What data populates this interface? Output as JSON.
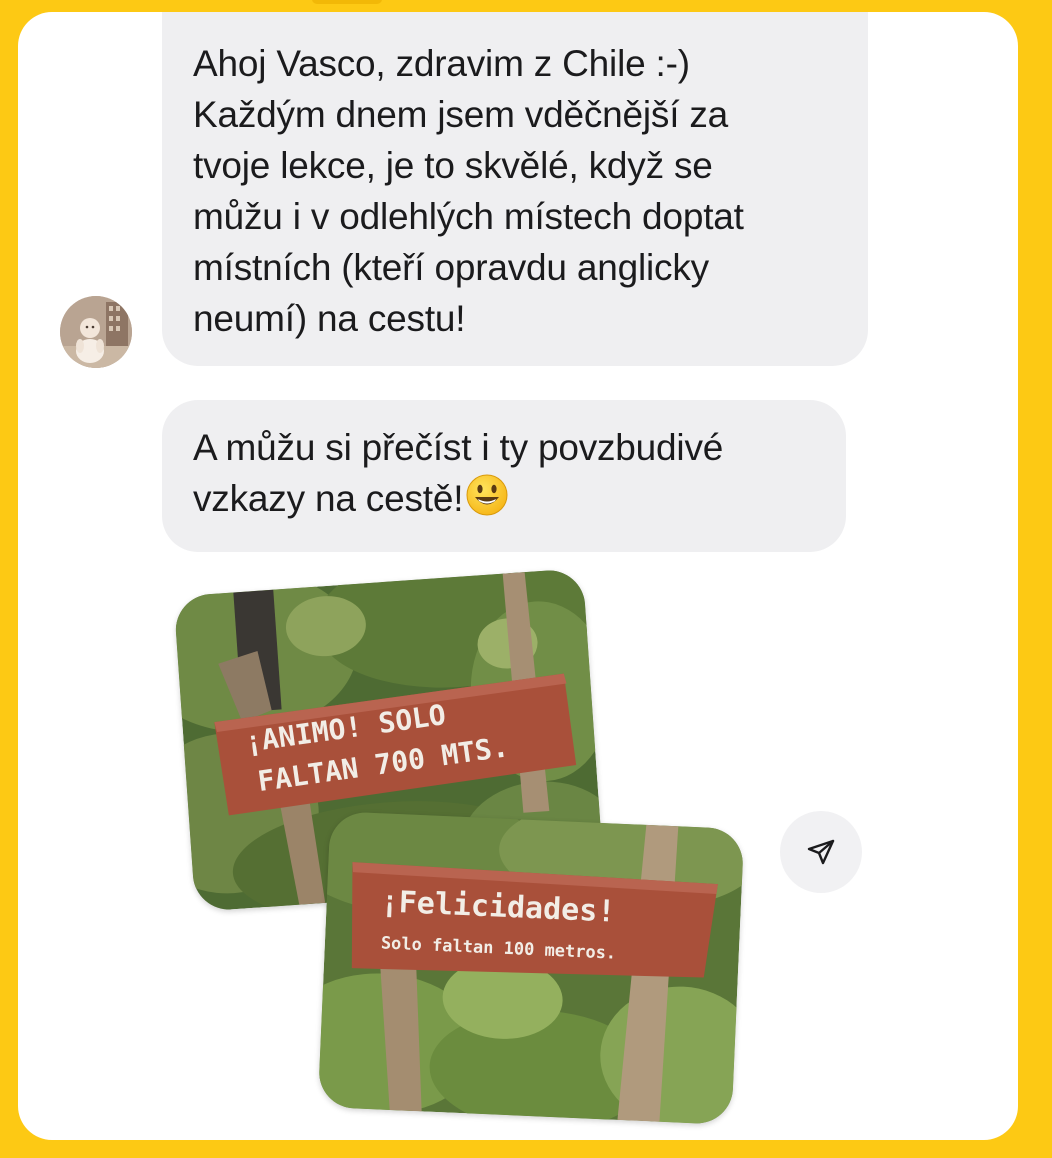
{
  "messages": [
    {
      "lines": [
        "Ahoj Vasco, zdravim z Chile :-)",
        "Každým dnem jsem vděčnější za",
        "tvoje lekce, je to skvělé, když se",
        "můžu i v odlehlých místech doptat",
        "místních (kteří opravdu anglicky",
        "neumí) na cestu!"
      ]
    },
    {
      "lines": [
        "A můžu si přečíst i ty povzbudivé",
        "vzkazy na cestě!"
      ],
      "emoji": "smiling-face-emoji"
    }
  ],
  "photos": [
    {
      "sign_lines": [
        "¡ANIMO! SOLO",
        "FALTAN 700 MTS."
      ]
    },
    {
      "sign_lines": [
        "¡Felicidades!",
        "Solo faltan 100 metros."
      ]
    }
  ],
  "icons": {
    "share": "paper-plane-icon",
    "avatar": "profile-photo"
  },
  "colors": {
    "background": "#FDC914",
    "card": "#FFFFFF",
    "bubble": "#EFEFF1",
    "text": "#1B1B1D",
    "sign": "#A9503A"
  }
}
